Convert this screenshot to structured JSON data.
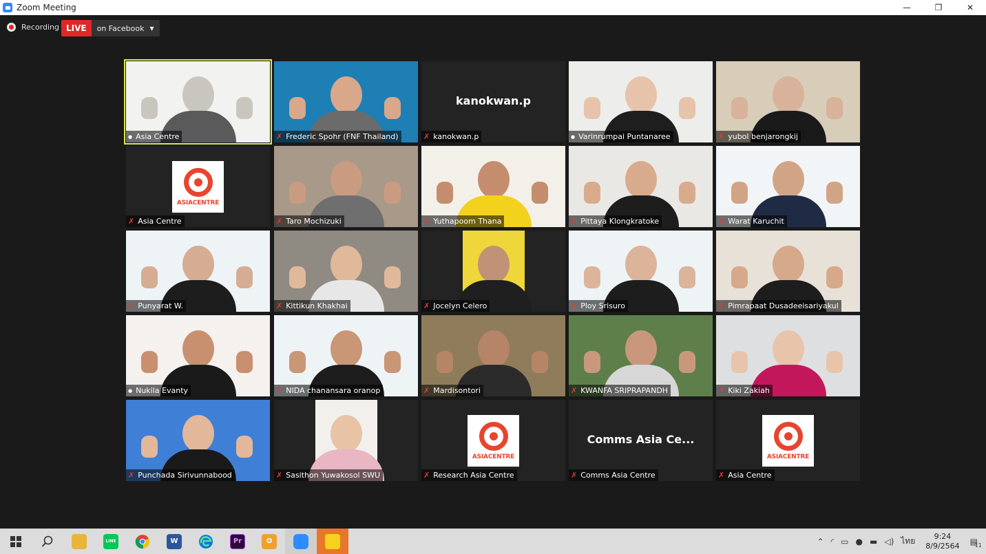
{
  "window": {
    "title": "Zoom Meeting",
    "minimize": "—",
    "maximize": "❐",
    "close": "✕"
  },
  "recording": {
    "label": "Recording"
  },
  "live": {
    "badge": "LIVE",
    "destination": "on Facebook",
    "caret": "▼"
  },
  "tiles": [
    {
      "name": "Asia Centre",
      "kind": "video",
      "active": true,
      "muted": false
    },
    {
      "name": "Frederic Spohr (FNF Thailand)",
      "kind": "video",
      "muted": true
    },
    {
      "name": "kanokwan.p",
      "kind": "text",
      "display": "kanokwan.p",
      "muted": true
    },
    {
      "name": "Varinrumpai Puntanaree",
      "kind": "video",
      "muted": false
    },
    {
      "name": "yubol benjarongkij",
      "kind": "video",
      "muted": true
    },
    {
      "name": "Asia Centre",
      "kind": "logo",
      "muted": true
    },
    {
      "name": "Taro Mochizuki",
      "kind": "video",
      "muted": true
    },
    {
      "name": "Yuthapoom Thana",
      "kind": "video",
      "muted": true
    },
    {
      "name": "Pittaya Klongkratoke",
      "kind": "video",
      "muted": true
    },
    {
      "name": "Warat Karuchit",
      "kind": "video",
      "muted": true
    },
    {
      "name": "Punyarat W.",
      "kind": "video",
      "muted": true
    },
    {
      "name": "Kittikun Khakhai",
      "kind": "video",
      "muted": true
    },
    {
      "name": "Jocelyn Celero",
      "kind": "portrait",
      "muted": true
    },
    {
      "name": "Ploy Srisuro",
      "kind": "video",
      "muted": true
    },
    {
      "name": "Pimrapaat Dusadeeisariyakul",
      "kind": "video",
      "muted": true
    },
    {
      "name": "Nukila Evanty",
      "kind": "video",
      "muted": false
    },
    {
      "name": "NIDA chanansara oranop",
      "kind": "video",
      "muted": true
    },
    {
      "name": "Mardisontori",
      "kind": "video",
      "muted": true
    },
    {
      "name": "KWANFA SRIPRAPANDH",
      "kind": "video",
      "muted": true
    },
    {
      "name": "Kiki Zakiah",
      "kind": "video",
      "muted": true
    },
    {
      "name": "Punchada Sirivunnabood",
      "kind": "video",
      "muted": true
    },
    {
      "name": "Sasithon Yuwakosol SWU",
      "kind": "portrait",
      "muted": true
    },
    {
      "name": "Research Asia Centre",
      "kind": "logo",
      "muted": true
    },
    {
      "name": "Comms Asia Centre",
      "kind": "text",
      "display": "Comms  Asia  Ce...",
      "muted": true
    },
    {
      "name": "Asia Centre",
      "kind": "logo",
      "muted": true
    }
  ],
  "logo_word": "ASIACENTRE",
  "colors": {
    "active_border": "#d8e84a",
    "mute": "#e03a3a",
    "live": "#e02828",
    "tile_bg": "#232323"
  },
  "taskbar": {
    "apps": [
      "windows-start",
      "search",
      "file-explorer",
      "line",
      "chrome",
      "word",
      "edge",
      "premiere",
      "outlook",
      "zoom",
      "sticky-notes"
    ],
    "word_label": "W",
    "premiere_label": "Pr",
    "outlook_label": "O",
    "line_label": "LINE",
    "language": "ไทย",
    "time": "9:24",
    "date": "8/9/2564",
    "notifications": "11"
  }
}
